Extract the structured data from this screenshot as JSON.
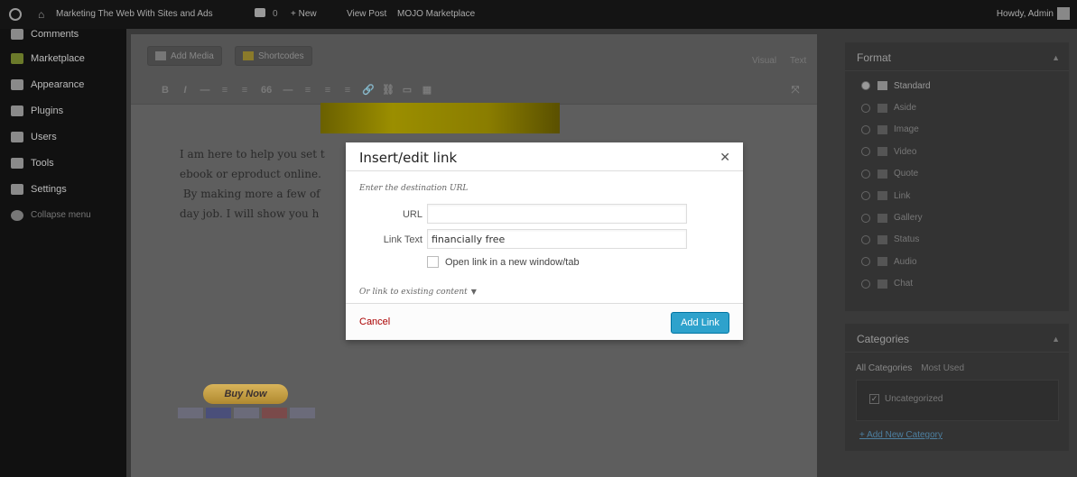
{
  "admin_bar": {
    "site_name": "Marketing The Web With Sites and Ads",
    "comment_count": "0",
    "new_label": "+ New",
    "view_post": "View Post",
    "mojo": "MOJO Marketplace",
    "howdy": "Howdy, Admin"
  },
  "sidebar": {
    "items": [
      {
        "label": "Comments",
        "icon": "comments-icon"
      },
      {
        "label": "Marketplace",
        "icon": "marketplace-icon"
      },
      {
        "label": "Appearance",
        "icon": "appearance-icon"
      },
      {
        "label": "Plugins",
        "icon": "plugins-icon"
      },
      {
        "label": "Users",
        "icon": "users-icon"
      },
      {
        "label": "Tools",
        "icon": "tools-icon"
      },
      {
        "label": "Settings",
        "icon": "settings-icon"
      },
      {
        "label": "Collapse menu",
        "icon": "collapse-icon"
      }
    ]
  },
  "editor": {
    "add_media": "Add Media",
    "shortcodes": "Shortcodes",
    "tab_visual": "Visual",
    "tab_text": "Text",
    "toolbar": [
      "B",
      "I",
      "—",
      "≡",
      "≡",
      "66",
      "—",
      "≡",
      "≡",
      "≡",
      "🔗",
      "⛓",
      "▭",
      "▦"
    ],
    "content_lines": [
      "I am here to help you set t",
      "ebook or eproduct online.",
      " By making more a few of",
      "day job. I will show you h"
    ],
    "buy_now": "Buy Now"
  },
  "format_panel": {
    "title": "Format",
    "options": [
      "Standard",
      "Aside",
      "Image",
      "Video",
      "Quote",
      "Link",
      "Gallery",
      "Status",
      "Audio",
      "Chat"
    ],
    "selected": "Standard"
  },
  "categories_panel": {
    "title": "Categories",
    "tab_all": "All Categories",
    "tab_most_used": "Most Used",
    "category": "Uncategorized",
    "add_new": "+ Add New Category"
  },
  "modal": {
    "title": "Insert/edit link",
    "hint": "Enter the destination URL",
    "url_label": "URL",
    "url_value": "",
    "link_text_label": "Link Text",
    "link_text_value": "financially free",
    "new_window_label": "Open link in a new window/tab",
    "existing_label": "Or link to existing content",
    "cancel": "Cancel",
    "add_link": "Add Link"
  }
}
